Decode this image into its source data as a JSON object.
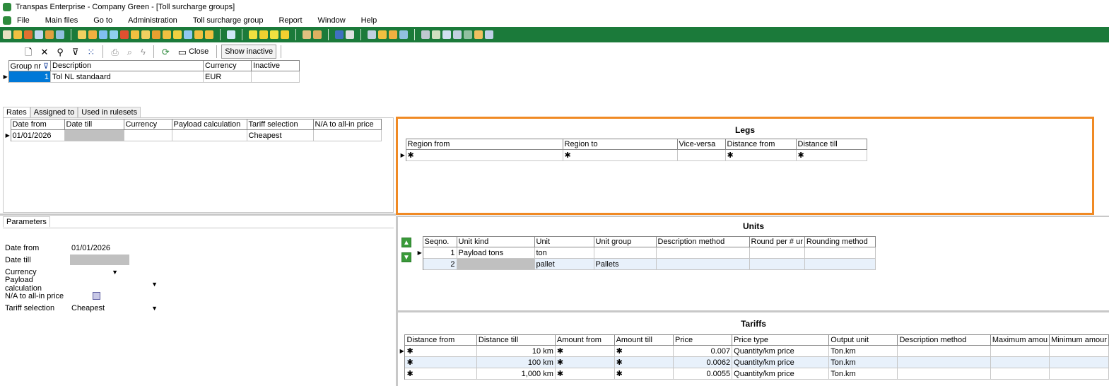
{
  "window": {
    "title": "Transpas Enterprise - Company Green - [Toll surcharge groups]"
  },
  "menu": [
    "File",
    "Main files",
    "Go to",
    "Administration",
    "Toll surcharge group",
    "Report",
    "Window",
    "Help"
  ],
  "toolbar": {
    "close_label": "Close",
    "show_inactive_label": "Show inactive"
  },
  "groups": {
    "headers": [
      "Group nr",
      "Description",
      "Currency",
      "Inactive"
    ],
    "rows": [
      {
        "nr": "1",
        "description": "Tol NL standaard",
        "currency": "EUR",
        "inactive": ""
      }
    ]
  },
  "rate_tabs": [
    "Rates",
    "Assigned to",
    "Used in rulesets"
  ],
  "rates": {
    "headers": [
      "Date from",
      "Date till",
      "Currency",
      "Payload calculation",
      "Tariff selection",
      "N/A to all-in price"
    ],
    "rows": [
      {
        "date_from": "01/01/2026",
        "date_till": "",
        "currency": "",
        "payload": "",
        "tariff": "Cheapest",
        "na": ""
      }
    ]
  },
  "legs": {
    "title": "Legs",
    "headers": [
      "Region from",
      "Region to",
      "Vice-versa",
      "Distance from",
      "Distance till"
    ],
    "new_row_marker": "✱"
  },
  "parameters": {
    "tab": "Parameters",
    "fields": [
      {
        "label": "Date from",
        "value": "01/01/2026"
      },
      {
        "label": "Date till",
        "value": ""
      },
      {
        "label": "Currency",
        "value": ""
      },
      {
        "label": "Payload calculation",
        "value": ""
      },
      {
        "label": "N/A to all-in price",
        "value": ""
      },
      {
        "label": "Tariff selection",
        "value": "Cheapest"
      }
    ]
  },
  "units": {
    "title": "Units",
    "headers": [
      "Seqno.",
      "Unit kind",
      "Unit",
      "Unit group",
      "Description method",
      "Round per # ur",
      "Rounding method"
    ],
    "rows": [
      {
        "seq": "1",
        "kind": "Payload tons",
        "unit": "ton",
        "group": "",
        "desc": "",
        "round": "",
        "method": ""
      },
      {
        "seq": "2",
        "kind": "",
        "unit": "pallet",
        "group": "Pallets",
        "desc": "",
        "round": "",
        "method": ""
      }
    ]
  },
  "tariffs": {
    "title": "Tariffs",
    "headers": [
      "Distance from",
      "Distance till",
      "Amount from",
      "Amount till",
      "Price",
      "Price type",
      "Output unit",
      "Description method",
      "Maximum amou",
      "Minimum amour"
    ],
    "rows": [
      {
        "dfrom": "✱",
        "dtill": "10 km",
        "afrom": "✱",
        "atill": "✱",
        "price": "0.007",
        "ptype": "Quantity/km price",
        "unit": "Ton.km"
      },
      {
        "dfrom": "✱",
        "dtill": "100 km",
        "afrom": "✱",
        "atill": "✱",
        "price": "0.0062",
        "ptype": "Quantity/km price",
        "unit": "Ton.km"
      },
      {
        "dfrom": "✱",
        "dtill": "1,000 km",
        "afrom": "✱",
        "atill": "✱",
        "price": "0.0055",
        "ptype": "Quantity/km price",
        "unit": "Ton.km"
      }
    ]
  },
  "colors": {
    "green_toolbar": "#1b7a3a",
    "highlight": "#f08a24",
    "selection": "#0078d7"
  }
}
